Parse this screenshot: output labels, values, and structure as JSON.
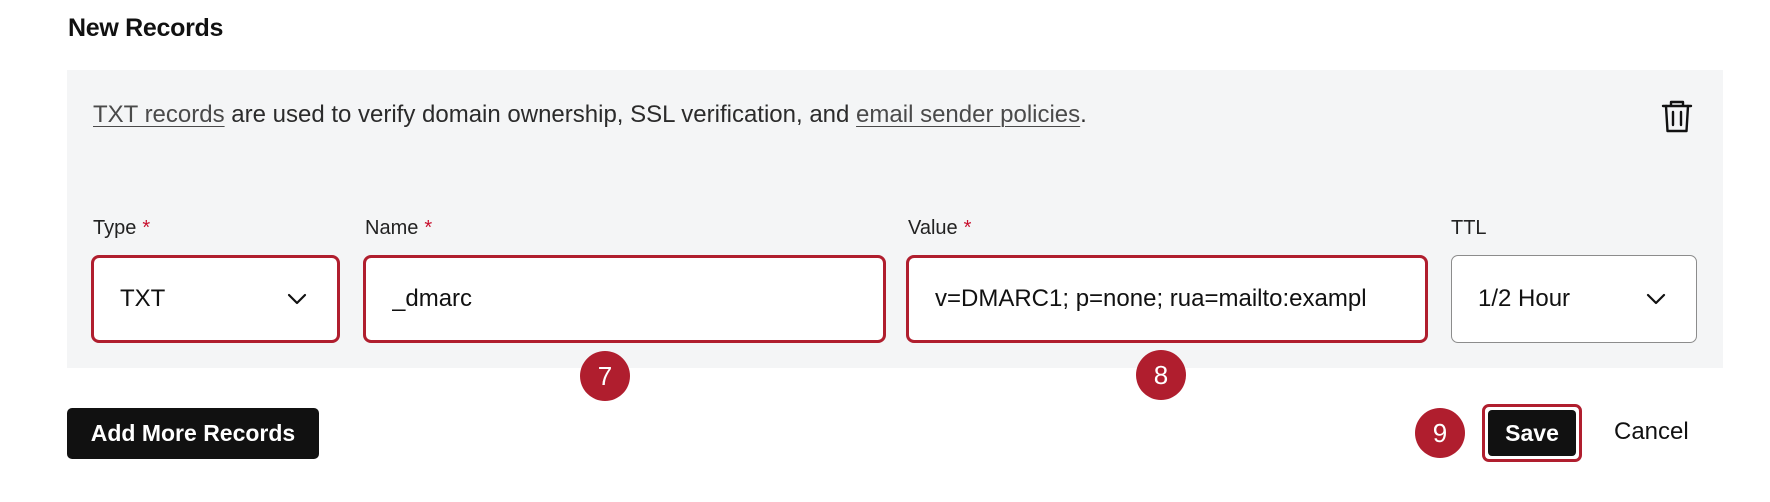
{
  "section": {
    "title": "New Records"
  },
  "panel": {
    "description": {
      "link1": "TXT records",
      "middle": " are used to verify domain ownership, SSL verification, and ",
      "link2": "email sender policies",
      "end": "."
    },
    "delete_icon": "trash-icon",
    "fields": {
      "type": {
        "label": "Type",
        "required": "*",
        "value": "TXT"
      },
      "name": {
        "label": "Name",
        "required": "*",
        "value": "_dmarc"
      },
      "value": {
        "label": "Value",
        "required": "*",
        "value": "v=DMARC1; p=none; rua=mailto:exampl"
      },
      "ttl": {
        "label": "TTL",
        "value": "1/2 Hour"
      }
    }
  },
  "annotations": {
    "step_name": "7",
    "step_value": "8",
    "step_save": "9",
    "color": "#b01e2e"
  },
  "actions": {
    "add_more": "Add More Records",
    "save": "Save",
    "cancel": "Cancel"
  }
}
